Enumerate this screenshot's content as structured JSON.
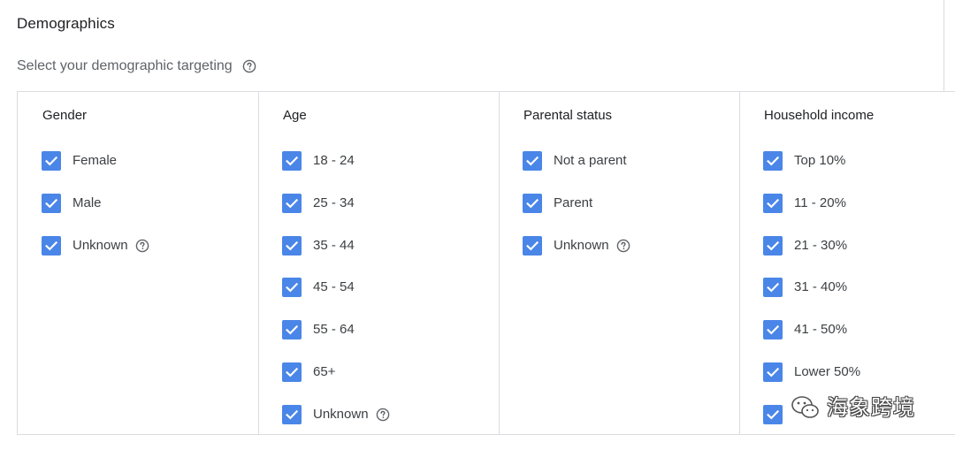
{
  "section": {
    "title": "Demographics",
    "subtitle": "Select your demographic targeting"
  },
  "icons": {
    "help": "help-circle-icon",
    "check": "checkmark-icon"
  },
  "colors": {
    "checkbox": "#4a86e8",
    "divider": "#dadce0",
    "muted_text": "#5f6368"
  },
  "columns": [
    {
      "header": "Gender",
      "options": [
        {
          "label": "Female",
          "checked": true,
          "help": false
        },
        {
          "label": "Male",
          "checked": true,
          "help": false
        },
        {
          "label": "Unknown",
          "checked": true,
          "help": true
        }
      ]
    },
    {
      "header": "Age",
      "options": [
        {
          "label": "18 - 24",
          "checked": true,
          "help": false
        },
        {
          "label": "25 - 34",
          "checked": true,
          "help": false
        },
        {
          "label": "35 - 44",
          "checked": true,
          "help": false
        },
        {
          "label": "45 - 54",
          "checked": true,
          "help": false
        },
        {
          "label": "55 - 64",
          "checked": true,
          "help": false
        },
        {
          "label": "65+",
          "checked": true,
          "help": false
        },
        {
          "label": "Unknown",
          "checked": true,
          "help": true
        }
      ]
    },
    {
      "header": "Parental status",
      "options": [
        {
          "label": "Not a parent",
          "checked": true,
          "help": false
        },
        {
          "label": "Parent",
          "checked": true,
          "help": false
        },
        {
          "label": "Unknown",
          "checked": true,
          "help": true
        }
      ]
    },
    {
      "header": "Household income",
      "options": [
        {
          "label": "Top 10%",
          "checked": true,
          "help": false
        },
        {
          "label": "11 - 20%",
          "checked": true,
          "help": false
        },
        {
          "label": "21 - 30%",
          "checked": true,
          "help": false
        },
        {
          "label": "31 - 40%",
          "checked": true,
          "help": false
        },
        {
          "label": "41 - 50%",
          "checked": true,
          "help": false
        },
        {
          "label": "Lower 50%",
          "checked": true,
          "help": false
        },
        {
          "label": "",
          "checked": true,
          "help": false
        }
      ]
    }
  ],
  "watermark": {
    "text": "海象跨境"
  }
}
